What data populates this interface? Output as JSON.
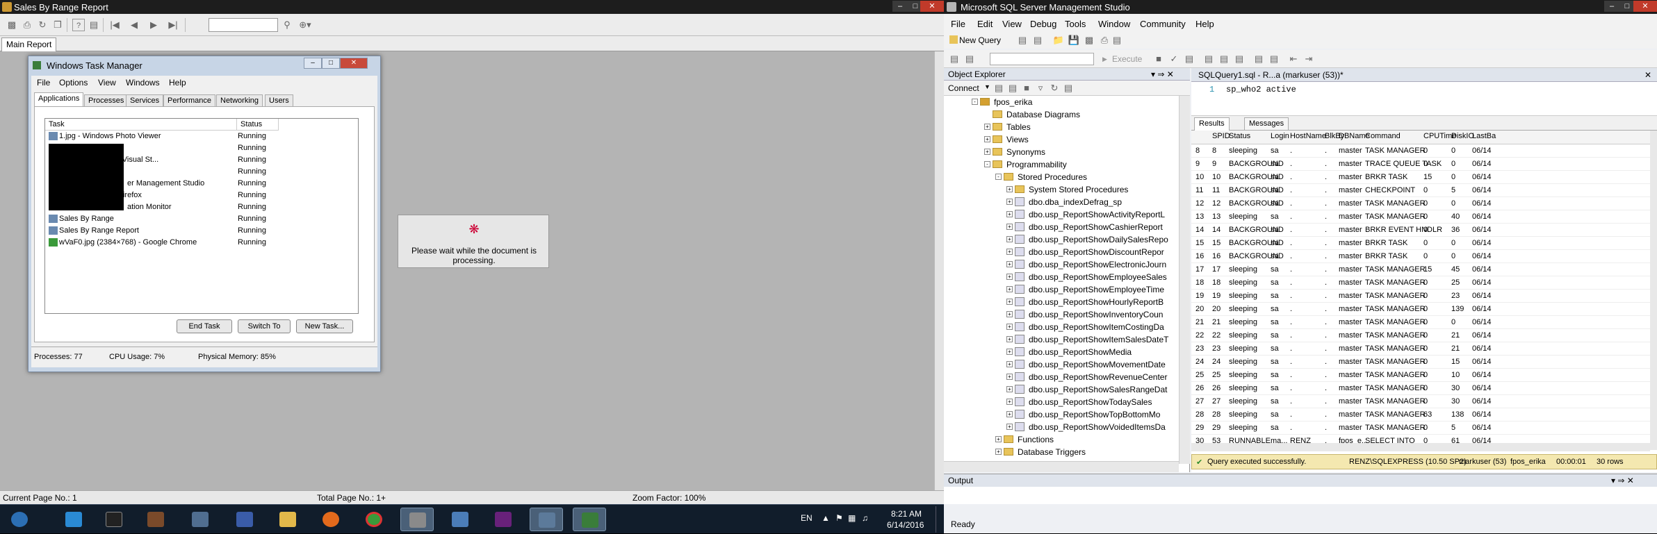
{
  "report": {
    "title": "Sales By Range Report",
    "tab": "Main Report",
    "status_current": "Current Page No.: 1",
    "status_total": "Total Page No.: 1+",
    "status_zoom": "Zoom Factor: 100%",
    "wait_message": "Please wait while the document is processing."
  },
  "taskmgr": {
    "title": "Windows Task Manager",
    "menu": [
      "File",
      "Options",
      "View",
      "Windows",
      "Help"
    ],
    "tabs": [
      "Applications",
      "Processes",
      "Services",
      "Performance",
      "Networking",
      "Users"
    ],
    "col_task": "Task",
    "col_status": "Status",
    "rows": [
      {
        "task": "1.jpg - Windows Photo Viewer",
        "status": "Running"
      },
      {
        "task": "",
        "status": "Running"
      },
      {
        "task": "(Running) - Microsoft Visual St...",
        "status": "Running"
      },
      {
        "task": "",
        "status": "Running"
      },
      {
        "task": "er Management Studio",
        "status": "Running"
      },
      {
        "task": "POS Slack - Mozilla Firefox",
        "status": "Running"
      },
      {
        "task": "ation Monitor",
        "status": "Running"
      },
      {
        "task": "Sales By Range",
        "status": "Running"
      },
      {
        "task": "Sales By Range Report",
        "status": "Running"
      },
      {
        "task": "wVaF0.jpg (2384×768) - Google Chrome",
        "status": "Running"
      }
    ],
    "btn_end": "End Task",
    "btn_switch": "Switch To",
    "btn_new": "New Task...",
    "processes": "Processes: 77",
    "cpu": "CPU Usage: 7%",
    "memory": "Physical Memory: 85%"
  },
  "ssms": {
    "title": "Microsoft SQL Server Management Studio",
    "menu": [
      "File",
      "Edit",
      "View",
      "Debug",
      "Tools",
      "Window",
      "Community",
      "Help"
    ],
    "new_query": "New Query",
    "execute": "Execute",
    "oe_title": "Object Explorer",
    "connect": "Connect",
    "tree": [
      {
        "label": "fpos_erika",
        "depth": 0,
        "kind": "db",
        "exp": "-"
      },
      {
        "label": "Database Diagrams",
        "depth": 1,
        "kind": "folder",
        "exp": ""
      },
      {
        "label": "Tables",
        "depth": 1,
        "kind": "folder",
        "exp": "+"
      },
      {
        "label": "Views",
        "depth": 1,
        "kind": "folder",
        "exp": "+"
      },
      {
        "label": "Synonyms",
        "depth": 1,
        "kind": "folder",
        "exp": "+"
      },
      {
        "label": "Programmability",
        "depth": 1,
        "kind": "folder",
        "exp": "-"
      },
      {
        "label": "Stored Procedures",
        "depth": 2,
        "kind": "folder",
        "exp": "-"
      },
      {
        "label": "System Stored Procedures",
        "depth": 3,
        "kind": "folder",
        "exp": "+"
      },
      {
        "label": "dbo.dba_indexDefrag_sp",
        "depth": 3,
        "kind": "sp",
        "exp": "+"
      },
      {
        "label": "dbo.usp_ReportShowActivityReportL",
        "depth": 3,
        "kind": "sp",
        "exp": "+"
      },
      {
        "label": "dbo.usp_ReportShowCashierReport",
        "depth": 3,
        "kind": "sp",
        "exp": "+"
      },
      {
        "label": "dbo.usp_ReportShowDailySalesRepo",
        "depth": 3,
        "kind": "sp",
        "exp": "+"
      },
      {
        "label": "dbo.usp_ReportShowDiscountRepor",
        "depth": 3,
        "kind": "sp",
        "exp": "+"
      },
      {
        "label": "dbo.usp_ReportShowElectronicJourn",
        "depth": 3,
        "kind": "sp",
        "exp": "+"
      },
      {
        "label": "dbo.usp_ReportShowEmployeeSales",
        "depth": 3,
        "kind": "sp",
        "exp": "+"
      },
      {
        "label": "dbo.usp_ReportShowEmployeeTime",
        "depth": 3,
        "kind": "sp",
        "exp": "+"
      },
      {
        "label": "dbo.usp_ReportShowHourlyReportB",
        "depth": 3,
        "kind": "sp",
        "exp": "+"
      },
      {
        "label": "dbo.usp_ReportShowInventoryCoun",
        "depth": 3,
        "kind": "sp",
        "exp": "+"
      },
      {
        "label": "dbo.usp_ReportShowItemCostingDa",
        "depth": 3,
        "kind": "sp",
        "exp": "+"
      },
      {
        "label": "dbo.usp_ReportShowItemSalesDateT",
        "depth": 3,
        "kind": "sp",
        "exp": "+"
      },
      {
        "label": "dbo.usp_ReportShowMedia",
        "depth": 3,
        "kind": "sp",
        "exp": "+"
      },
      {
        "label": "dbo.usp_ReportShowMovementDate",
        "depth": 3,
        "kind": "sp",
        "exp": "+"
      },
      {
        "label": "dbo.usp_ReportShowRevenueCenter",
        "depth": 3,
        "kind": "sp",
        "exp": "+"
      },
      {
        "label": "dbo.usp_ReportShowSalesRangeDat",
        "depth": 3,
        "kind": "sp",
        "exp": "+"
      },
      {
        "label": "dbo.usp_ReportShowTodaySales",
        "depth": 3,
        "kind": "sp",
        "exp": "+"
      },
      {
        "label": "dbo.usp_ReportShowTopBottomMo",
        "depth": 3,
        "kind": "sp",
        "exp": "+"
      },
      {
        "label": "dbo.usp_ReportShowVoidedItemsDa",
        "depth": 3,
        "kind": "sp",
        "exp": "+"
      },
      {
        "label": "Functions",
        "depth": 2,
        "kind": "folder",
        "exp": "+"
      },
      {
        "label": "Database Triggers",
        "depth": 2,
        "kind": "folder",
        "exp": "+"
      }
    ],
    "query_tab": "SQLQuery1.sql - R...a (markuser (53))*",
    "line_no": "1",
    "code": "sp_who2 active",
    "results_tab": "Results",
    "messages_tab": "Messages",
    "columns": [
      "SPID",
      "Status",
      "Login",
      "HostName",
      "BlkBy",
      "DBName",
      "Command",
      "CPUTime",
      "DiskIO",
      "LastBa"
    ],
    "rows": [
      [
        "8",
        "8",
        "sleeping",
        "sa",
        ".",
        ".",
        "master",
        "TASK MANAGER",
        "0",
        "0",
        "06/14"
      ],
      [
        "9",
        "9",
        "BACKGROUND",
        "sa",
        ".",
        ".",
        "master",
        "TRACE QUEUE TASK",
        "0",
        "0",
        "06/14"
      ],
      [
        "10",
        "10",
        "BACKGROUND",
        "sa",
        ".",
        ".",
        "master",
        "BRKR TASK",
        "15",
        "0",
        "06/14"
      ],
      [
        "11",
        "11",
        "BACKGROUND",
        "sa",
        ".",
        ".",
        "master",
        "CHECKPOINT",
        "0",
        "5",
        "06/14"
      ],
      [
        "12",
        "12",
        "BACKGROUND",
        "sa",
        ".",
        ".",
        "master",
        "TASK MANAGER",
        "0",
        "0",
        "06/14"
      ],
      [
        "13",
        "13",
        "sleeping",
        "sa",
        ".",
        ".",
        "master",
        "TASK MANAGER",
        "0",
        "40",
        "06/14"
      ],
      [
        "14",
        "14",
        "BACKGROUND",
        "sa",
        ".",
        ".",
        "master",
        "BRKR EVENT HNDLR",
        "0",
        "36",
        "06/14"
      ],
      [
        "15",
        "15",
        "BACKGROUND",
        "sa",
        ".",
        ".",
        "master",
        "BRKR TASK",
        "0",
        "0",
        "06/14"
      ],
      [
        "16",
        "16",
        "BACKGROUND",
        "sa",
        ".",
        ".",
        "master",
        "BRKR TASK",
        "0",
        "0",
        "06/14"
      ],
      [
        "17",
        "17",
        "sleeping",
        "sa",
        ".",
        ".",
        "master",
        "TASK MANAGER",
        "15",
        "45",
        "06/14"
      ],
      [
        "18",
        "18",
        "sleeping",
        "sa",
        ".",
        ".",
        "master",
        "TASK MANAGER",
        "0",
        "25",
        "06/14"
      ],
      [
        "19",
        "19",
        "sleeping",
        "sa",
        ".",
        ".",
        "master",
        "TASK MANAGER",
        "0",
        "23",
        "06/14"
      ],
      [
        "20",
        "20",
        "sleeping",
        "sa",
        ".",
        ".",
        "master",
        "TASK MANAGER",
        "0",
        "139",
        "06/14"
      ],
      [
        "21",
        "21",
        "sleeping",
        "sa",
        ".",
        ".",
        "master",
        "TASK MANAGER",
        "0",
        "0",
        "06/14"
      ],
      [
        "22",
        "22",
        "sleeping",
        "sa",
        ".",
        ".",
        "master",
        "TASK MANAGER",
        "0",
        "21",
        "06/14"
      ],
      [
        "23",
        "23",
        "sleeping",
        "sa",
        ".",
        ".",
        "master",
        "TASK MANAGER",
        "0",
        "21",
        "06/14"
      ],
      [
        "24",
        "24",
        "sleeping",
        "sa",
        ".",
        ".",
        "master",
        "TASK MANAGER",
        "0",
        "15",
        "06/14"
      ],
      [
        "25",
        "25",
        "sleeping",
        "sa",
        ".",
        ".",
        "master",
        "TASK MANAGER",
        "0",
        "10",
        "06/14"
      ],
      [
        "26",
        "26",
        "sleeping",
        "sa",
        ".",
        ".",
        "master",
        "TASK MANAGER",
        "0",
        "30",
        "06/14"
      ],
      [
        "27",
        "27",
        "sleeping",
        "sa",
        ".",
        ".",
        "master",
        "TASK MANAGER",
        "0",
        "30",
        "06/14"
      ],
      [
        "28",
        "28",
        "sleeping",
        "sa",
        ".",
        ".",
        "master",
        "TASK MANAGER",
        "63",
        "138",
        "06/14"
      ],
      [
        "29",
        "29",
        "sleeping",
        "sa",
        ".",
        ".",
        "master",
        "TASK MANAGER",
        "0",
        "5",
        "06/14"
      ],
      [
        "30",
        "53",
        "RUNNABLE",
        "ma...",
        "RENZ",
        ".",
        "fpos_e...",
        "SELECT INTO",
        "0",
        "61",
        "06/14"
      ]
    ],
    "q_success": "Query executed successfully.",
    "q_server": "RENZ\\SQLEXPRESS (10.50 SP2)",
    "q_user": "markuser (53)",
    "q_db": "fpos_erika",
    "q_time": "00:00:01",
    "q_rows": "30 rows",
    "output_title": "Output",
    "ready": "Ready"
  },
  "taskbar": {
    "lang": "EN",
    "time": "8:21 AM",
    "date": "6/14/2016"
  },
  "colors": {
    "titlebar": "#1d1d1d",
    "taskbar": "#111d2b",
    "query_status": "#f4e8b0",
    "close_button": "#c13a2a"
  }
}
